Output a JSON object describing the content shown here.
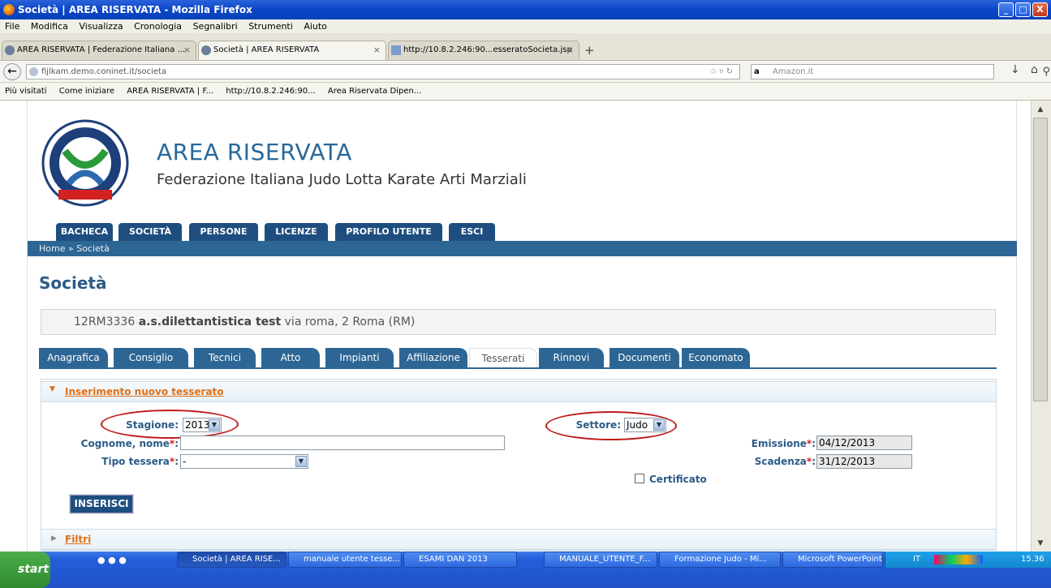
{
  "window": {
    "title": "Società | AREA RISERVATA - Mozilla Firefox",
    "min": "_",
    "max": "□",
    "close": "X"
  },
  "menu": [
    "File",
    "Modifica",
    "Visualizza",
    "Cronologia",
    "Segnalibri",
    "Strumenti",
    "Aiuto"
  ],
  "tabs": [
    {
      "label": "AREA RISERVATA | Federazione Italiana ...",
      "close": "×"
    },
    {
      "label": "Società | AREA RISERVATA",
      "close": "×"
    },
    {
      "label": "http://10.8.2.246:90...esseratoSocieta.jsp",
      "close": "×"
    }
  ],
  "newtab": "+",
  "nav": {
    "url": "fijlkam.demo.coninet.it/societa",
    "search_placeholder": "Amazon.it"
  },
  "bookmarks": [
    "Più visitati",
    "Come iniziare",
    "AREA RISERVATA | F...",
    "http://10.8.2.246:90...",
    "Area Riservata Dipen..."
  ],
  "site": {
    "title": "AREA RISERVATA",
    "subtitle": "Federazione Italiana Judo Lotta Karate Arti Marziali",
    "menu": [
      "BACHECA",
      "SOCIETÀ",
      "PERSONE",
      "LICENZE",
      "PROFILO UTENTE",
      "ESCI"
    ],
    "breadcrumb": "Home » Società",
    "page_title": "Società",
    "info": {
      "code": "12RM3336",
      "name": "a.s.dilettantistica test",
      "address": "via roma, 2 Roma (RM)"
    },
    "subtabs": [
      "Anagrafica",
      "Consiglio",
      "Tecnici",
      "Atto",
      "Impianti",
      "Affiliazione",
      "Tesserati",
      "Rinnovi",
      "Documenti",
      "Economato"
    ]
  },
  "form": {
    "section": "Inserimento nuovo tesserato",
    "stagione_label": "Stagione:",
    "stagione_value": "2013",
    "cognome_label": "Cognome, nome",
    "cognome_value": "",
    "tipo_label": "Tipo tessera",
    "tipo_value": "-",
    "settore_label": "Settore:",
    "settore_value": "Judo",
    "emissione_label": "Emissione",
    "emissione_value": "04/12/2013",
    "scadenza_label": "Scadenza",
    "scadenza_value": "31/12/2013",
    "certificato_label": "Certificato",
    "submit": "INSERISCI",
    "req": "*",
    "colon": ":"
  },
  "filtri": "Filtri",
  "taskbar": {
    "start": "start",
    "items": [
      "Società | AREA RISE...",
      "manuale utente tesse...",
      "ESAMI DAN 2013",
      "MANUALE_UTENTE_F...",
      "Formazione Judo - Mi...",
      "Microsoft PowerPoint ..."
    ],
    "lang": "IT",
    "clock": "15.36"
  }
}
